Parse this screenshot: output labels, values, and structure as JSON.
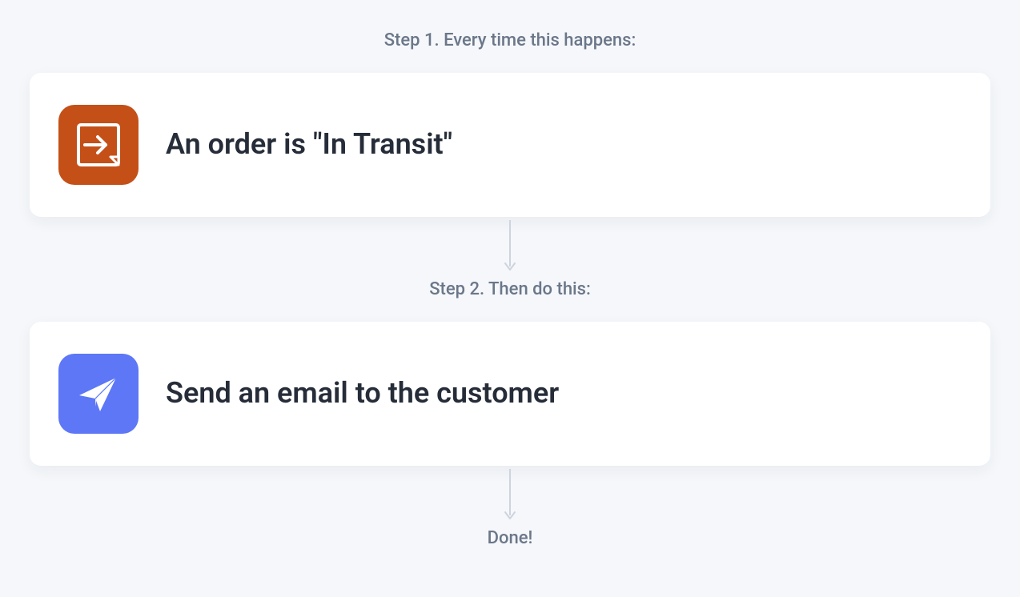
{
  "step1": {
    "label": "Step 1. Every time this happens:",
    "title": "An order is \"In Transit\"",
    "icon": "box-arrow-icon",
    "icon_color": "#c45018"
  },
  "step2": {
    "label": "Step 2. Then do this:",
    "title": "Send an email to the customer",
    "icon": "paper-plane-icon",
    "icon_color": "#5d77f6"
  },
  "done_label": "Done!"
}
